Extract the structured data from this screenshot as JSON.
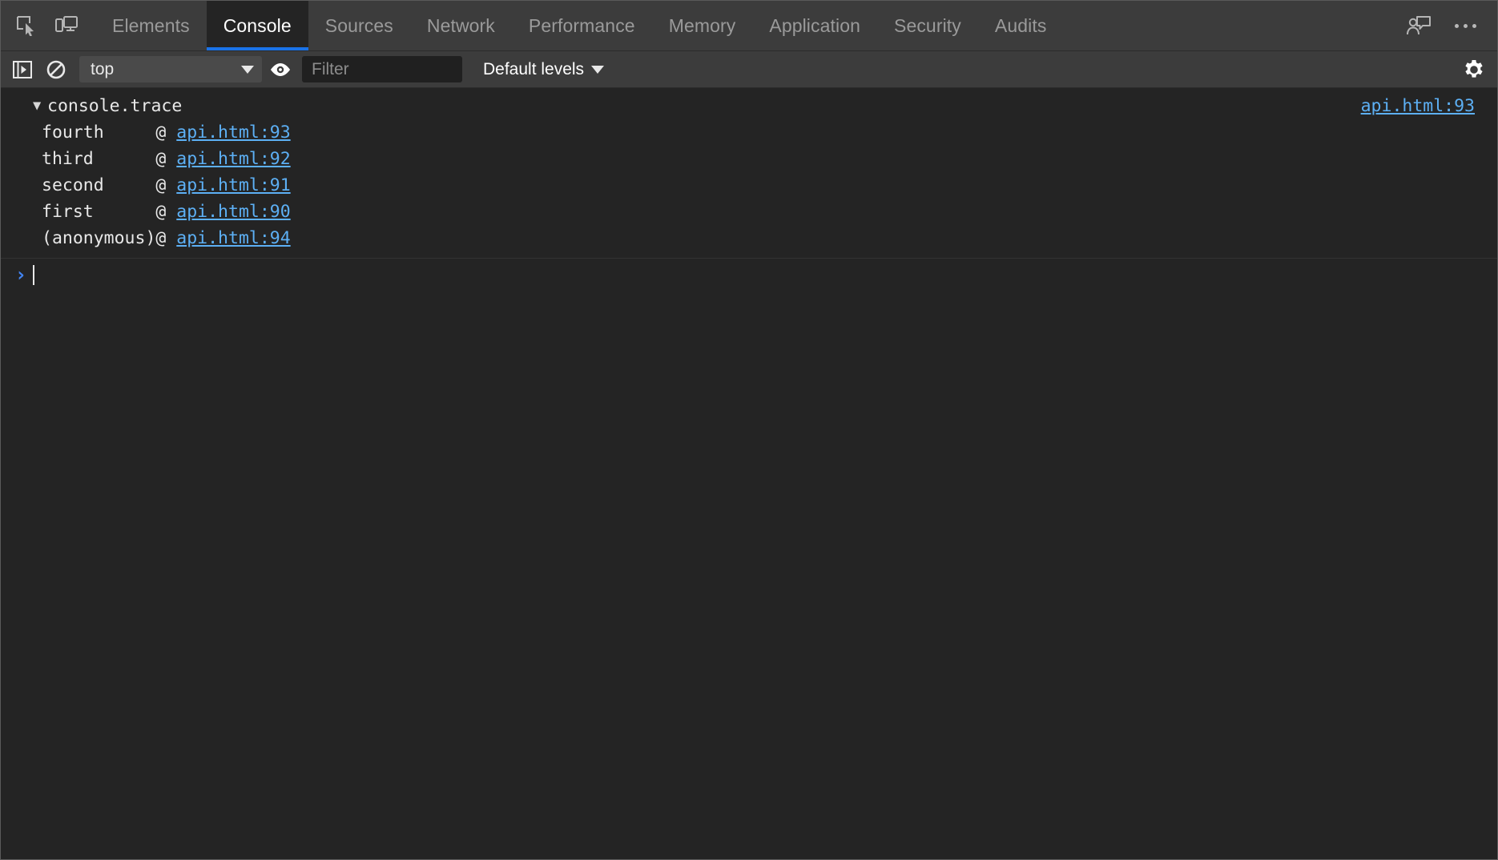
{
  "window": {
    "title": "DevTools",
    "background_color": "#242424",
    "toolbar_color": "#3c3c3c",
    "accent_color": "#1a73e8",
    "link_color": "#5db0f5"
  },
  "tabbar": {
    "inspect_icon": "inspect-element-icon",
    "device_toolbar_icon": "device-toolbar-icon",
    "tabs": [
      {
        "label": "Elements",
        "active": false
      },
      {
        "label": "Console",
        "active": true
      },
      {
        "label": "Sources",
        "active": false
      },
      {
        "label": "Network",
        "active": false
      },
      {
        "label": "Performance",
        "active": false
      },
      {
        "label": "Memory",
        "active": false
      },
      {
        "label": "Application",
        "active": false
      },
      {
        "label": "Security",
        "active": false
      },
      {
        "label": "Audits",
        "active": false
      }
    ],
    "feedback_icon": "person-feedback-icon",
    "more_icon": "more-options-icon"
  },
  "console_toolbar": {
    "sidebar_toggle_icon": "console-sidebar-toggle-icon",
    "clear_icon": "clear-console-icon",
    "context": {
      "value": "top",
      "caret_icon": "chevron-down-icon"
    },
    "eye_icon": "live-expression-eye-icon",
    "filter": {
      "value": "",
      "placeholder": "Filter"
    },
    "levels": {
      "label": "Default levels",
      "caret_icon": "chevron-down-icon"
    },
    "settings_icon": "gear-icon"
  },
  "console": {
    "trace": {
      "disclosure_icon": "triangle-down-icon",
      "title": "console.trace",
      "source_link": "api.html:93",
      "frames": [
        {
          "fn": "fourth",
          "at": "@",
          "link": "api.html:93"
        },
        {
          "fn": "third",
          "at": "@",
          "link": "api.html:92"
        },
        {
          "fn": "second",
          "at": "@",
          "link": "api.html:91"
        },
        {
          "fn": "first",
          "at": "@",
          "link": "api.html:90"
        },
        {
          "fn": "(anonymous)",
          "at": "@",
          "link": "api.html:94"
        }
      ],
      "fn_column_width": 11
    },
    "prompt": {
      "chevron": "›",
      "value": ""
    }
  }
}
